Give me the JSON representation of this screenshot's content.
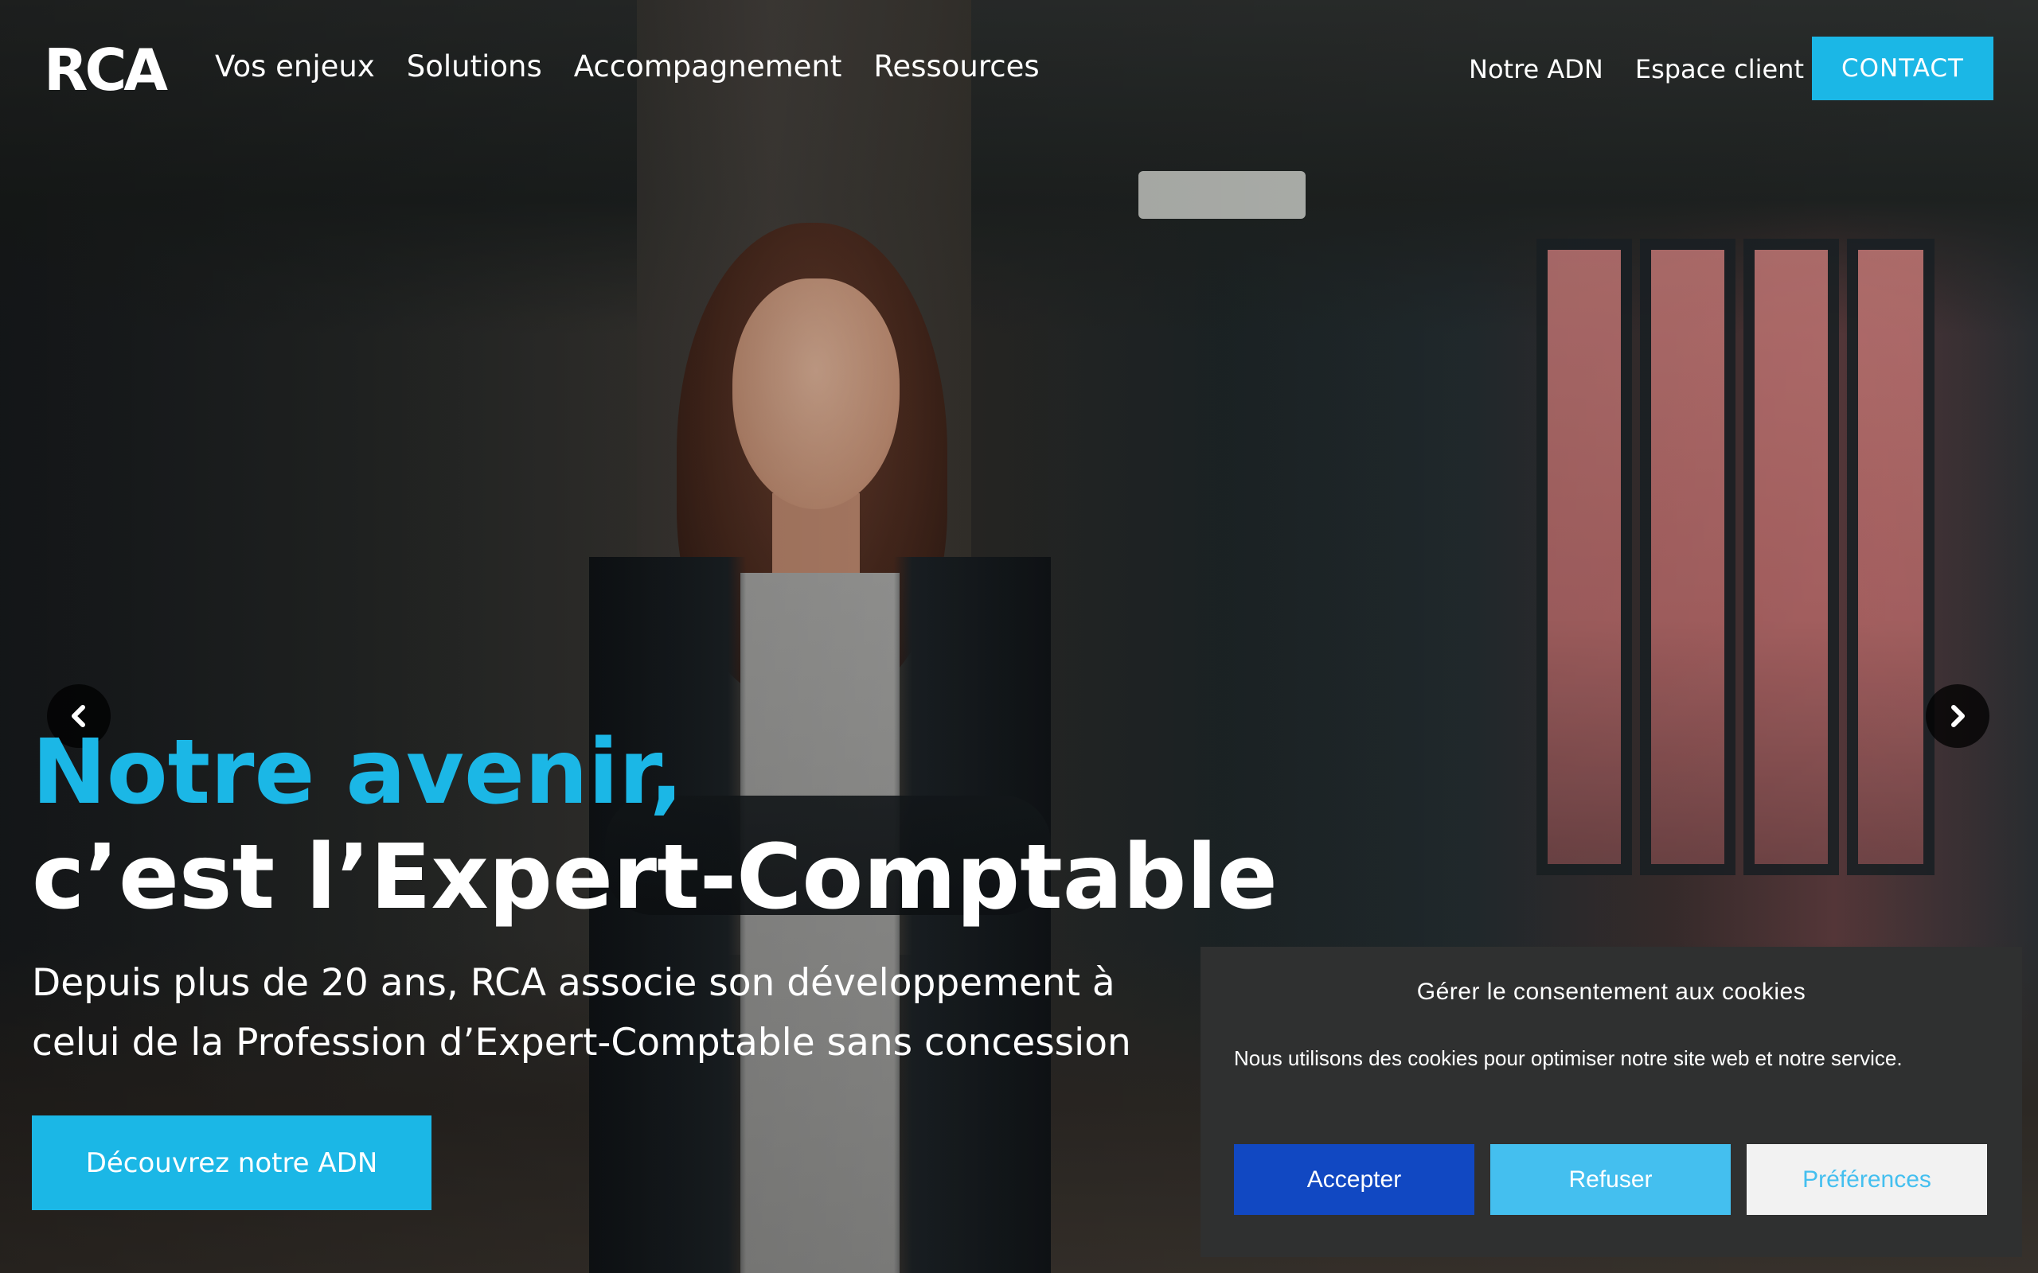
{
  "colors": {
    "accent": "#1bb7e6",
    "cookie_bg": "#2f3030",
    "accept_bg": "#1148c2",
    "refuse_bg": "#44bfef",
    "prefs_bg": "#f2f2f2"
  },
  "header": {
    "logo_text": "RCA",
    "nav_main": [
      "Vos enjeux",
      "Solutions",
      "Accompagnement",
      "Ressources"
    ],
    "nav_secondary": [
      "Notre ADN",
      "Espace client"
    ],
    "contact_label": "CONTACT"
  },
  "carousel": {
    "prev_icon": "chevron-left-icon",
    "next_icon": "chevron-right-icon"
  },
  "hero": {
    "title_line1": "Notre avenir,",
    "title_line2": "c’est l’Expert-Comptable",
    "subtitle": "Depuis plus de 20 ans, RCA associe son développement à celui de la Profession d’Expert-Comptable sans concession",
    "cta_label": "Découvrez notre ADN"
  },
  "cookie_banner": {
    "title": "Gérer le consentement aux cookies",
    "text": "Nous utilisons des cookies pour optimiser notre site web et notre service.",
    "accept_label": "Accepter",
    "refuse_label": "Refuser",
    "prefs_label": "Préférences"
  }
}
